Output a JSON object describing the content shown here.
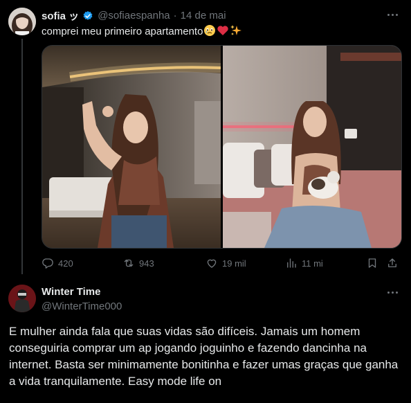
{
  "tweet": {
    "author_name": "sofia ッ",
    "handle": "@sofiaespanha",
    "separator": "·",
    "date": "14 de mai",
    "text": "comprei meu primeiro apartamento",
    "emojis": [
      "holding-back-tears",
      "red-heart",
      "sparkles"
    ],
    "actions": {
      "replies": "420",
      "retweets": "943",
      "likes": "19 mil",
      "views": "11 mi"
    }
  },
  "reply": {
    "author_name": "Winter Time",
    "handle": "@WinterTime000",
    "text": "E mulher ainda fala que suas vidas são difíceis. Jamais um homem conseguiria comprar um ap jogando joguinho e fazendo dancinha na internet. Basta ser minimamente bonitinha e fazer umas graças que ganha a vida tranquilamente. Easy mode life on"
  },
  "colors": {
    "background": "#000000",
    "text": "#e7e9ea",
    "muted": "#71767b",
    "verified": "#1d9bf0",
    "divider": "#333639"
  }
}
